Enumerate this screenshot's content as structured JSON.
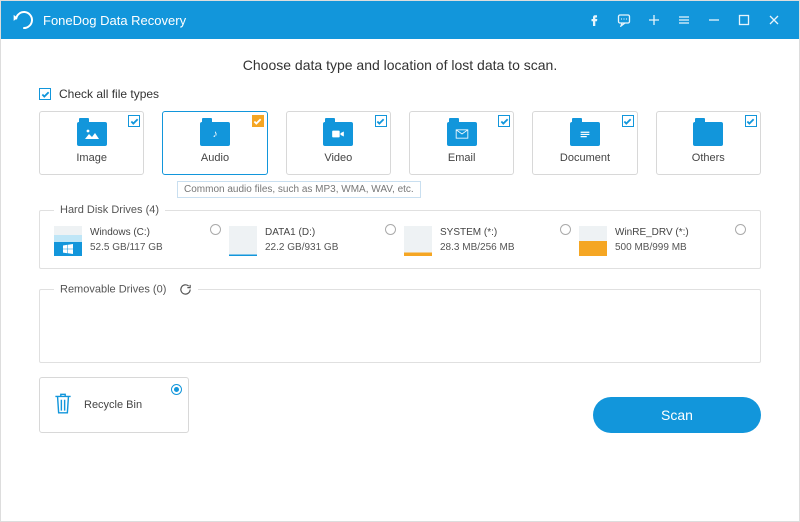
{
  "app": {
    "title": "FoneDog Data Recovery"
  },
  "heading": "Choose data type and location of lost data to scan.",
  "check_all_label": "Check all file types",
  "types": [
    {
      "label": "Image"
    },
    {
      "label": "Audio"
    },
    {
      "label": "Video"
    },
    {
      "label": "Email"
    },
    {
      "label": "Document"
    },
    {
      "label": "Others"
    }
  ],
  "tooltip": "Common audio files, such as MP3, WMA, WAV, etc.",
  "hdd": {
    "legend": "Hard Disk Drives (4)",
    "items": [
      {
        "name": "Windows (C:)",
        "size": "52.5 GB/117 GB",
        "fill": "#bfe6f7",
        "used": 0.45,
        "win": true
      },
      {
        "name": "DATA1 (D:)",
        "size": "22.2 GB/931 GB",
        "fill": "#1296db",
        "used": 0.05
      },
      {
        "name": "SYSTEM (*:)",
        "size": "28.3 MB/256 MB",
        "fill": "#f5a623",
        "used": 0.12
      },
      {
        "name": "WinRE_DRV (*:)",
        "size": "500 MB/999 MB",
        "fill": "#f5a623",
        "used": 0.5
      }
    ]
  },
  "removable": {
    "legend": "Removable Drives (0)"
  },
  "recycle_label": "Recycle Bin",
  "scan_label": "Scan"
}
